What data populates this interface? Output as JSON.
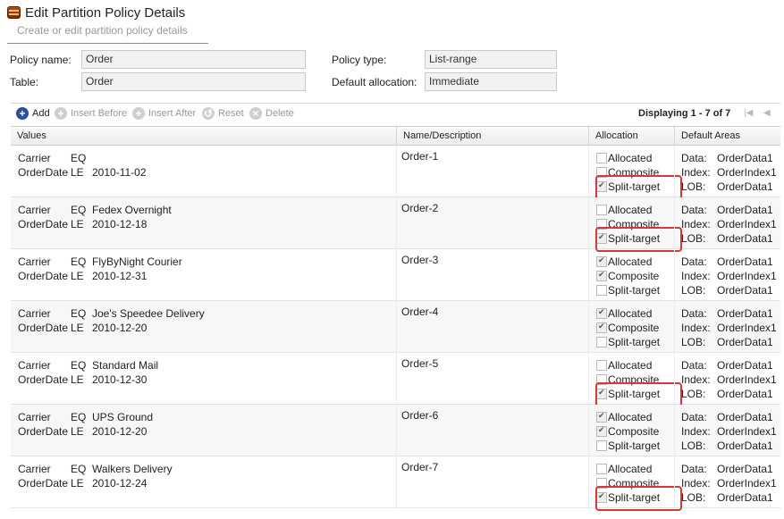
{
  "header": {
    "title": "Edit Partition Policy Details",
    "subtitle": "Create or edit partition policy details"
  },
  "form": {
    "policy_name_label": "Policy name:",
    "policy_name_value": "Order",
    "table_label": "Table:",
    "table_value": "Order",
    "policy_type_label": "Policy type:",
    "policy_type_value": "List-range",
    "default_allocation_label": "Default allocation:",
    "default_allocation_value": "Immediate"
  },
  "toolbar": {
    "add": "Add",
    "insert_before": "Insert Before",
    "insert_after": "Insert After",
    "reset": "Reset",
    "delete": "Delete",
    "displaying": "Displaying 1 - 7 of 7"
  },
  "columns": [
    "Values",
    "Name/Description",
    "Allocation",
    "Default Areas"
  ],
  "rows": [
    {
      "carrier_key": "Carrier",
      "carrier_op": "EQ",
      "carrier_val": "",
      "date_key": "OrderDate",
      "date_op": "LE",
      "date_val": "2010-11-02",
      "name": "Order-1",
      "alloc": [
        {
          "label": "Allocated",
          "checked": false
        },
        {
          "label": "Composite",
          "checked": false
        },
        {
          "label": "Split-target",
          "checked": true
        }
      ],
      "areas": [
        {
          "k": "Data:",
          "v": "OrderData1"
        },
        {
          "k": "Index:",
          "v": "OrderIndex1"
        },
        {
          "k": "LOB:",
          "v": "OrderData1"
        }
      ],
      "highlight": true
    },
    {
      "carrier_key": "Carrier",
      "carrier_op": "EQ",
      "carrier_val": "Fedex Overnight",
      "date_key": "OrderDate",
      "date_op": "LE",
      "date_val": "2010-12-18",
      "name": "Order-2",
      "alloc": [
        {
          "label": "Allocated",
          "checked": false
        },
        {
          "label": "Composite",
          "checked": false
        },
        {
          "label": "Split-target",
          "checked": true
        }
      ],
      "areas": [
        {
          "k": "Data:",
          "v": "OrderData1"
        },
        {
          "k": "Index:",
          "v": "OrderIndex1"
        },
        {
          "k": "LOB:",
          "v": "OrderData1"
        }
      ],
      "highlight": true
    },
    {
      "carrier_key": "Carrier",
      "carrier_op": "EQ",
      "carrier_val": "FlyByNight Courier",
      "date_key": "OrderDate",
      "date_op": "LE",
      "date_val": "2010-12-31",
      "name": "Order-3",
      "alloc": [
        {
          "label": "Allocated",
          "checked": true
        },
        {
          "label": "Composite",
          "checked": true
        },
        {
          "label": "Split-target",
          "checked": false
        }
      ],
      "areas": [
        {
          "k": "Data:",
          "v": "OrderData1"
        },
        {
          "k": "Index:",
          "v": "OrderIndex1"
        },
        {
          "k": "LOB:",
          "v": "OrderData1"
        }
      ],
      "highlight": false
    },
    {
      "carrier_key": "Carrier",
      "carrier_op": "EQ",
      "carrier_val": "Joe's Speedee Delivery",
      "date_key": "OrderDate",
      "date_op": "LE",
      "date_val": "2010-12-20",
      "name": "Order-4",
      "alloc": [
        {
          "label": "Allocated",
          "checked": true
        },
        {
          "label": "Composite",
          "checked": true
        },
        {
          "label": "Split-target",
          "checked": false
        }
      ],
      "areas": [
        {
          "k": "Data:",
          "v": "OrderData1"
        },
        {
          "k": "Index:",
          "v": "OrderIndex1"
        },
        {
          "k": "LOB:",
          "v": "OrderData1"
        }
      ],
      "highlight": false
    },
    {
      "carrier_key": "Carrier",
      "carrier_op": "EQ",
      "carrier_val": "Standard Mail",
      "date_key": "OrderDate",
      "date_op": "LE",
      "date_val": "2010-12-30",
      "name": "Order-5",
      "alloc": [
        {
          "label": "Allocated",
          "checked": false
        },
        {
          "label": "Composite",
          "checked": false
        },
        {
          "label": "Split-target",
          "checked": true
        }
      ],
      "areas": [
        {
          "k": "Data:",
          "v": "OrderData1"
        },
        {
          "k": "Index:",
          "v": "OrderIndex1"
        },
        {
          "k": "LOB:",
          "v": "OrderData1"
        }
      ],
      "highlight": true
    },
    {
      "carrier_key": "Carrier",
      "carrier_op": "EQ",
      "carrier_val": "UPS Ground",
      "date_key": "OrderDate",
      "date_op": "LE",
      "date_val": "2010-12-20",
      "name": "Order-6",
      "alloc": [
        {
          "label": "Allocated",
          "checked": true
        },
        {
          "label": "Composite",
          "checked": true
        },
        {
          "label": "Split-target",
          "checked": false
        }
      ],
      "areas": [
        {
          "k": "Data:",
          "v": "OrderData1"
        },
        {
          "k": "Index:",
          "v": "OrderIndex1"
        },
        {
          "k": "LOB:",
          "v": "OrderData1"
        }
      ],
      "highlight": false
    },
    {
      "carrier_key": "Carrier",
      "carrier_op": "EQ",
      "carrier_val": "Walkers Delivery",
      "date_key": "OrderDate",
      "date_op": "LE",
      "date_val": "2010-12-24",
      "name": "Order-7",
      "alloc": [
        {
          "label": "Allocated",
          "checked": false
        },
        {
          "label": "Composite",
          "checked": false
        },
        {
          "label": "Split-target",
          "checked": true
        }
      ],
      "areas": [
        {
          "k": "Data:",
          "v": "OrderData1"
        },
        {
          "k": "Index:",
          "v": "OrderIndex1"
        },
        {
          "k": "LOB:",
          "v": "OrderData1"
        }
      ],
      "highlight": true
    }
  ],
  "colors": {
    "accent": "#2a4f9a",
    "highlight": "#d03a3a"
  }
}
